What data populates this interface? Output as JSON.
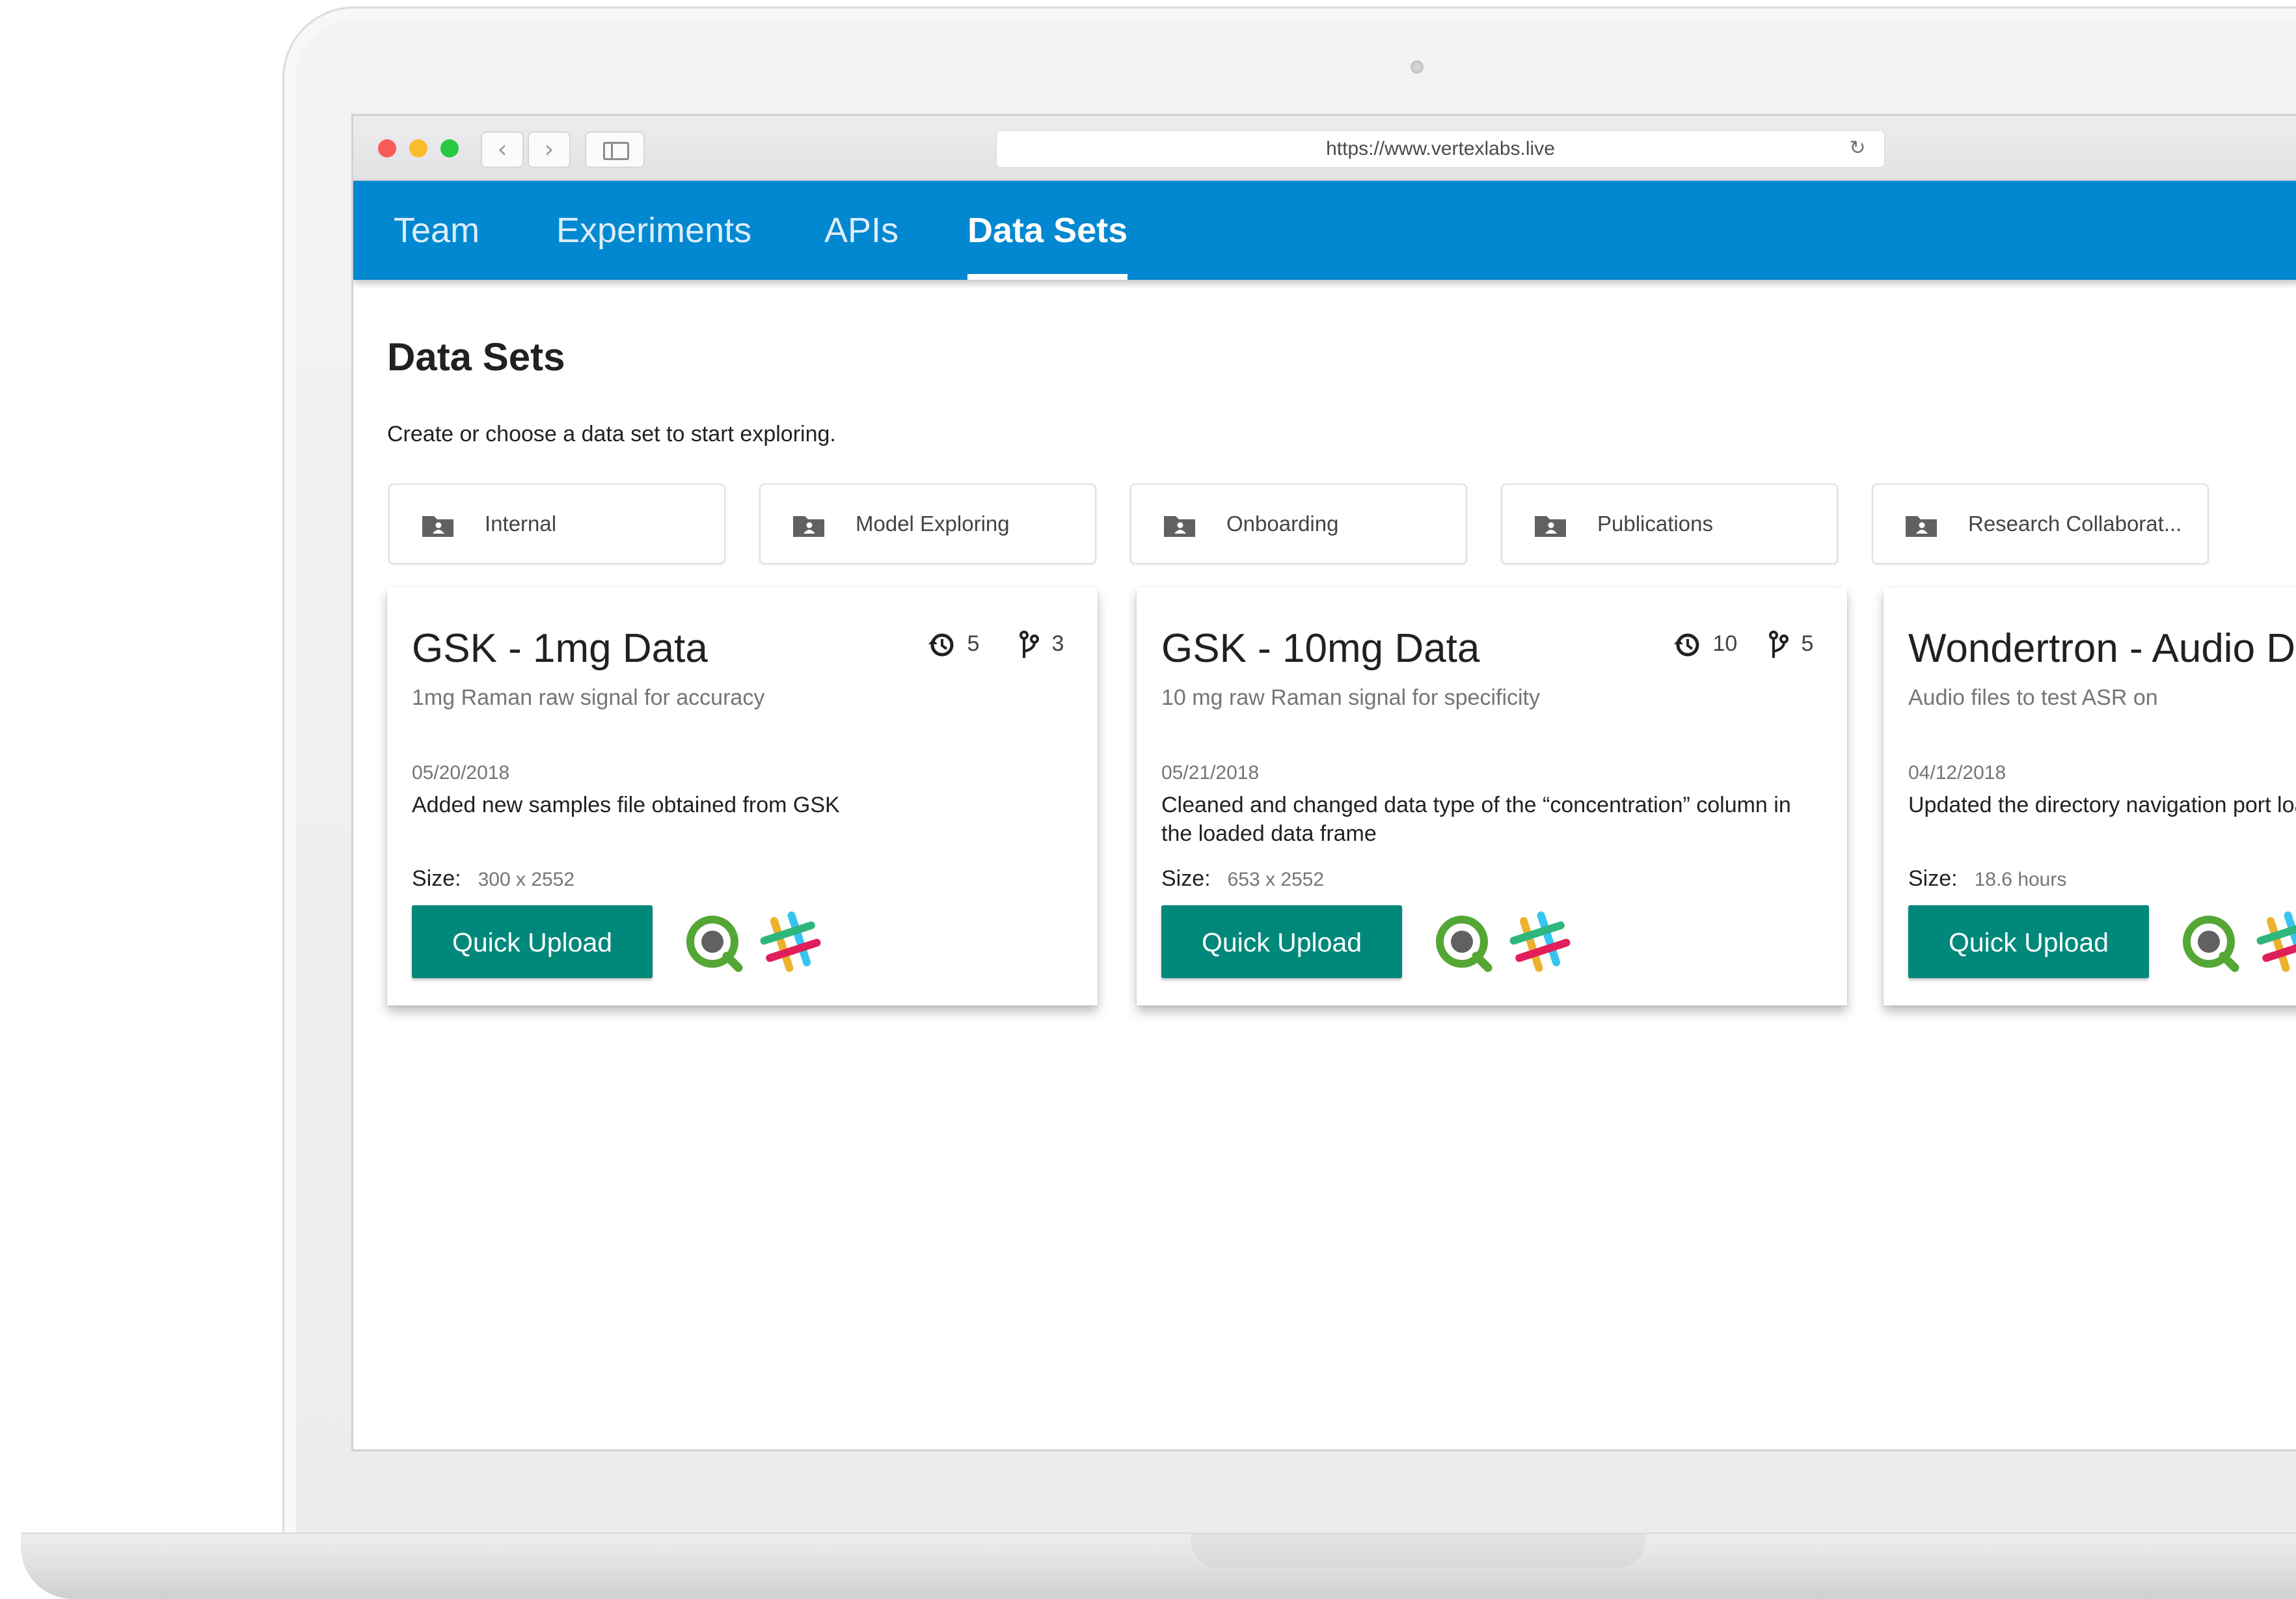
{
  "browser": {
    "url": "https://www.vertexlabs.live",
    "back_glyph": "‹",
    "forward_glyph": "›",
    "reload_glyph": "↻"
  },
  "nav": {
    "tabs": [
      {
        "label": "Team"
      },
      {
        "label": "Experiments"
      },
      {
        "label": "APIs"
      },
      {
        "label": "Data Sets",
        "active": true
      }
    ],
    "accent_color": "#0288d1"
  },
  "page": {
    "title": "Data Sets",
    "subtitle": "Create or choose a data set to start exploring."
  },
  "folders": [
    {
      "label": "Internal",
      "icon": "shared-folder-icon"
    },
    {
      "label": "Model Exploring",
      "icon": "shared-folder-icon"
    },
    {
      "label": "Onboarding",
      "icon": "shared-folder-icon"
    },
    {
      "label": "Publications",
      "icon": "shared-folder-icon"
    },
    {
      "label": "Research Collaborat...",
      "icon": "shared-folder-icon"
    }
  ],
  "datasets": [
    {
      "title": "GSK - 1mg Data",
      "description": "1mg Raman raw signal for accuracy",
      "history_count": "5",
      "branch_count": "3",
      "date": "05/20/2018",
      "note": "Added new samples file obtained from GSK",
      "size_label": "Size:",
      "size_value": "300 x 2552",
      "button_label": "Quick Upload"
    },
    {
      "title": "GSK - 10mg Data",
      "description": "10 mg raw Raman signal for specificity",
      "history_count": "10",
      "branch_count": "5",
      "date": "05/21/2018",
      "note": "Cleaned and changed data type of the “concentration” column in the loaded data frame",
      "size_label": "Size:",
      "size_value": "653 x 2552",
      "button_label": "Quick Upload"
    },
    {
      "title": "Wondertron - Audio D",
      "description": "Audio files to test ASR on",
      "date": "04/12/2018",
      "note": "Updated the directory navigation port loading scripts",
      "size_label": "Size:",
      "size_value": "18.6 hours",
      "button_label": "Quick Upload"
    }
  ],
  "colors": {
    "button": "#00897b",
    "qlik_green": "#54a734",
    "slack_blue": "#36c5f0",
    "slack_green": "#2eb67d",
    "slack_yellow": "#ecb22e",
    "slack_red": "#e01e5a"
  }
}
